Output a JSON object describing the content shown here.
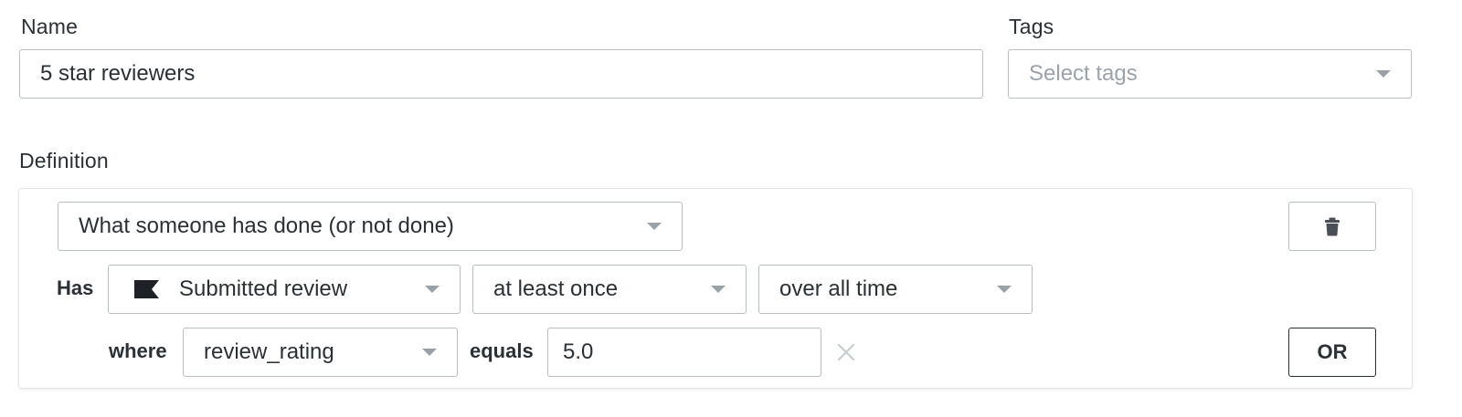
{
  "name_section": {
    "label": "Name",
    "value": "5 star reviewers"
  },
  "tags_section": {
    "label": "Tags",
    "placeholder": "Select tags"
  },
  "definition": {
    "label": "Definition",
    "condition_type": "What someone has done (or not done)",
    "has_label": "Has",
    "metric": "Submitted review",
    "frequency": "at least once",
    "timeframe": "over all time",
    "where_label": "where",
    "property": "review_rating",
    "operator_label": "equals",
    "value": "5.0",
    "or_button": "OR"
  },
  "icons": {
    "metric": "flag-icon",
    "delete": "trash-icon",
    "clear": "close-icon",
    "dropdown": "chevron-down-icon"
  }
}
